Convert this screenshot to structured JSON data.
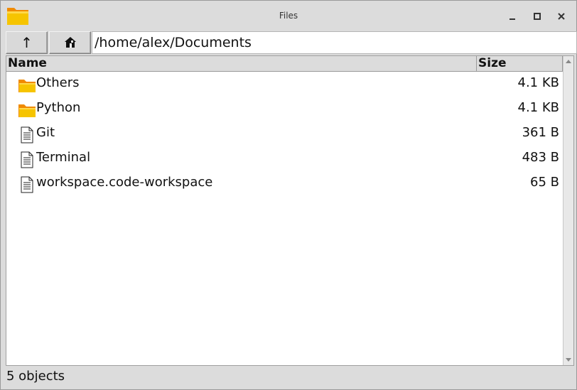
{
  "window": {
    "title": "Files",
    "app_icon": "folder-icon"
  },
  "toolbar": {
    "up_icon": "up-arrow-icon",
    "up_glyph": "↑",
    "home_icon": "home-icon",
    "path": "/home/alex/Documents"
  },
  "list": {
    "columns": {
      "name": "Name",
      "size": "Size"
    },
    "items": [
      {
        "name": "Others",
        "size": "4.1 KB",
        "type": "folder",
        "icon": "folder-icon"
      },
      {
        "name": "Python",
        "size": "4.1 KB",
        "type": "folder",
        "icon": "folder-icon"
      },
      {
        "name": "Git",
        "size": "361 B",
        "type": "file",
        "icon": "file-icon"
      },
      {
        "name": "Terminal",
        "size": "483 B",
        "type": "file",
        "icon": "file-icon"
      },
      {
        "name": "workspace.code-workspace",
        "size": "65 B",
        "type": "file",
        "icon": "file-icon"
      }
    ]
  },
  "status": {
    "text": "5 objects"
  },
  "colors": {
    "folder_front": "#f6c400",
    "folder_back": "#f08a00",
    "chrome": "#dcdcdc"
  }
}
